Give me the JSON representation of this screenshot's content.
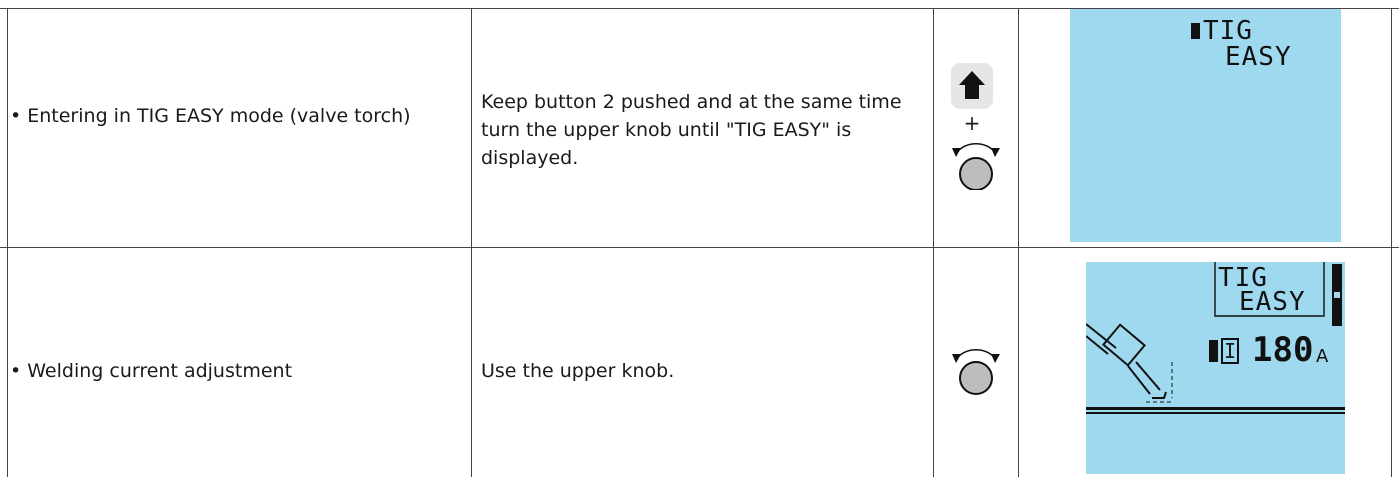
{
  "rows": [
    {
      "action": "• Entering in TIG EASY mode (valve torch)",
      "instruction": "Keep button 2 pushed and at the same time turn the upper knob until \"TIG EASY\" is displayed.",
      "controls": {
        "button_icon": "arrow-up-icon",
        "plus": "+",
        "knob_icon": "rotary-knob-icon"
      },
      "display": {
        "line1": "TIG",
        "line2": "EASY"
      }
    },
    {
      "action": "• Welding current adjustment",
      "instruction": "Use the upper knob.",
      "controls": {
        "knob_icon": "rotary-knob-icon"
      },
      "display": {
        "line1": "TIG",
        "line2": "EASY",
        "current_symbol": "I",
        "current_value": "180",
        "unit": "A"
      }
    }
  ],
  "colors": {
    "lcd": "#9fd9f0",
    "border": "#444444"
  }
}
